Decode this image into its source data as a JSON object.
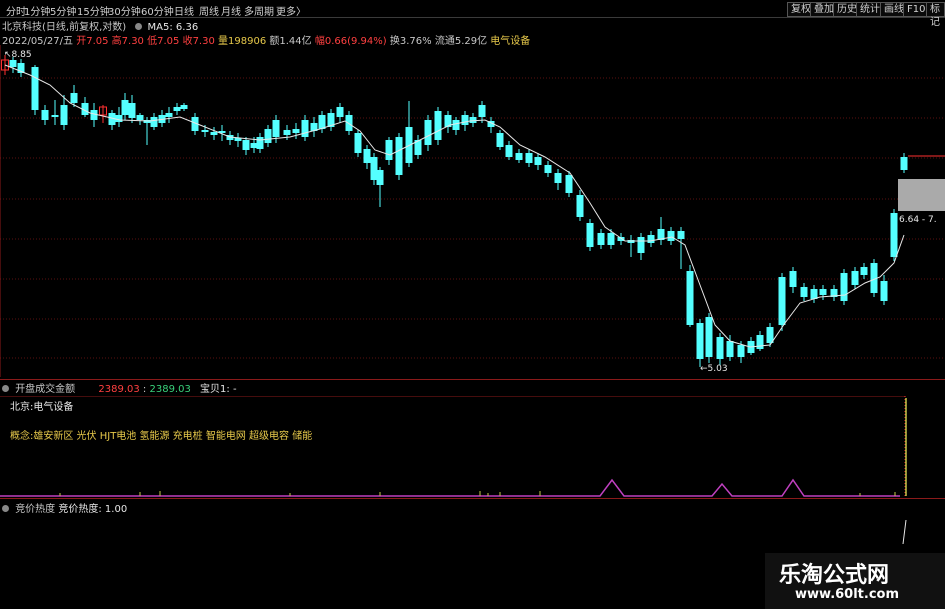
{
  "toolbar": {
    "periods": [
      "分时",
      "1分钟",
      "5分钟",
      "15分钟",
      "30分钟",
      "60分钟",
      "日线",
      "周线",
      "月线",
      "多周期",
      "更多〉"
    ],
    "right_buttons": [
      "复权",
      "叠加",
      "历史",
      "统计",
      "画线",
      "F10",
      "标记"
    ]
  },
  "header": {
    "title": "北京科技(日线,前复权,对数)",
    "ma_label": "MA5: 6.36",
    "date": "2022/05/27/五",
    "open_label": "开",
    "open": "7.05",
    "high_label": "高",
    "high": "7.30",
    "low_label": "低",
    "low": "7.05",
    "close_label": "收",
    "close": "7.30",
    "volume": "量198906",
    "amount": "额1.44亿",
    "change": "幅0.66(9.94%)",
    "turnover": "换3.76%",
    "float_cap": "流通5.29亿",
    "sector": "电气设备"
  },
  "chart_data": {
    "type": "candlestick",
    "annotations": {
      "high_mark": "8.85",
      "low_mark": "5.03",
      "price_tag": "6.64 - 7."
    },
    "ma_label": "MA5"
  },
  "panel2": {
    "title": "开盘成交金额",
    "value1": "2389.03",
    "value2": "2389.03",
    "value3": "宝贝1: -",
    "line1": "北京:电气设备",
    "line2": "概念:雄安新区 光伏 HJT电池 氢能源 充电桩 智能电网 超级电容 储能"
  },
  "panel3": {
    "title": "竞价热度",
    "value": "竞价热度: 1.00"
  },
  "watermark": {
    "brand": "乐淘公式网",
    "url": "www.60lt.com"
  },
  "colors": {
    "up": "#ff3030",
    "down": "#54ffff",
    "ma": "#e8e8e8",
    "bg": "#000000",
    "purple": "#c040c0"
  }
}
